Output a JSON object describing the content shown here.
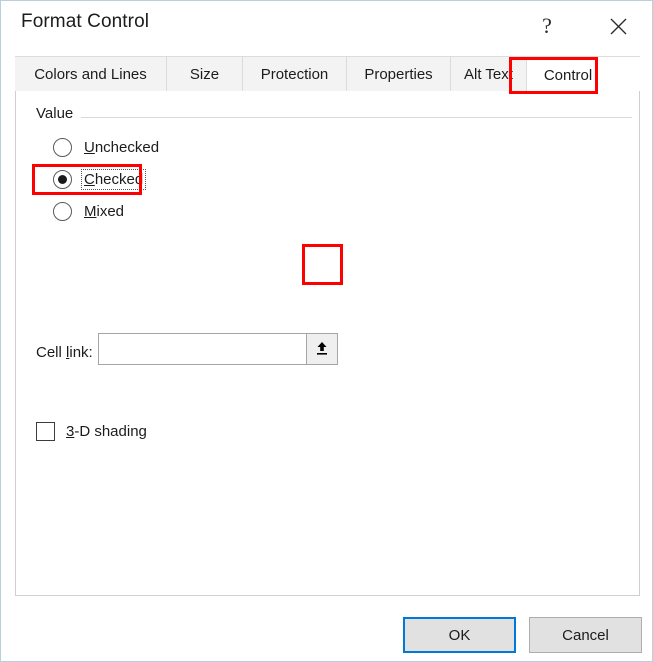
{
  "window": {
    "title": "Format Control",
    "help_label": "?",
    "close_label": "✕"
  },
  "tabs": [
    {
      "label": "Colors and Lines",
      "active": false
    },
    {
      "label": "Size",
      "active": false
    },
    {
      "label": "Protection",
      "active": false
    },
    {
      "label": "Properties",
      "active": false
    },
    {
      "label": "Alt Text",
      "active": false
    },
    {
      "label": "Control",
      "active": true
    }
  ],
  "control_tab": {
    "group_value_label": "Value",
    "radios": [
      {
        "label_before": "U",
        "mnemonic": "",
        "label": "Unchecked",
        "selected": false,
        "focused": false
      },
      {
        "label": "Checked",
        "selected": true,
        "focused": true
      },
      {
        "label": "Mixed",
        "selected": false,
        "focused": false
      }
    ],
    "cell_link": {
      "label": "Cell link:",
      "value": "",
      "placeholder": "",
      "range_select_icon": "collapse-dialog-arrow-icon"
    },
    "shading": {
      "label": "3-D shading",
      "checked": false
    }
  },
  "footer": {
    "ok_label": "OK",
    "cancel_label": "Cancel"
  },
  "annotations": {
    "accent_color": "#ff0000",
    "default_button_color": "#0078d7",
    "highlighted": [
      "control-tab",
      "checked-radio",
      "cell-link-range-button"
    ]
  }
}
